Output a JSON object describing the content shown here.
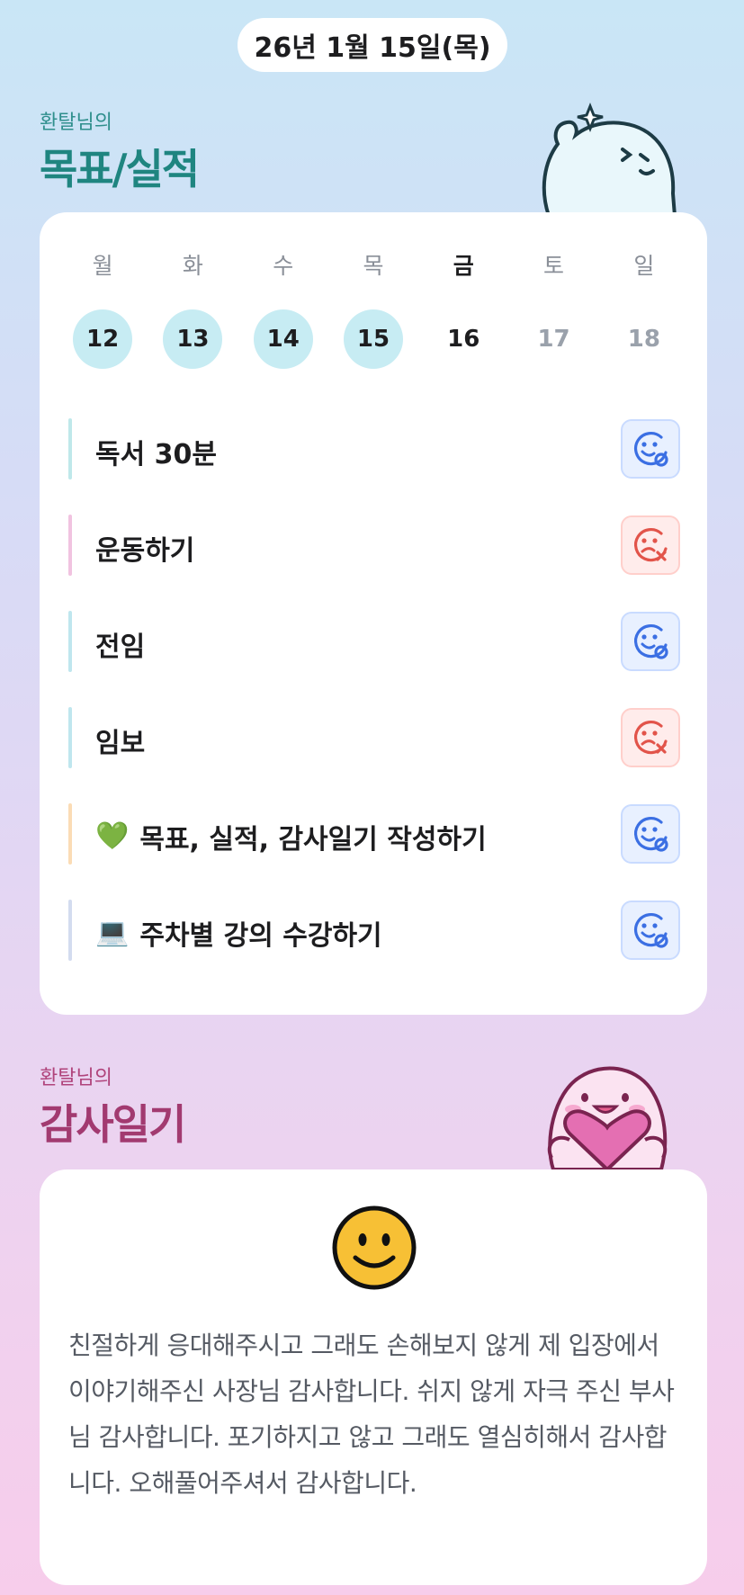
{
  "date_label": "26년 1월 15일(목)",
  "goals_section": {
    "subtitle": "환탈님의",
    "title": "목표/실적"
  },
  "week": {
    "days": [
      {
        "label": "월",
        "date": "12",
        "state": "done"
      },
      {
        "label": "화",
        "date": "13",
        "state": "done"
      },
      {
        "label": "수",
        "date": "14",
        "state": "done"
      },
      {
        "label": "목",
        "date": "15",
        "state": "done"
      },
      {
        "label": "금",
        "date": "16",
        "state": "today"
      },
      {
        "label": "토",
        "date": "17",
        "state": "future"
      },
      {
        "label": "일",
        "date": "18",
        "state": "future"
      }
    ]
  },
  "goals": [
    {
      "label": "독서 30분",
      "emoji": "",
      "status": "success",
      "bar_color": "#bfe8ea"
    },
    {
      "label": "운동하기",
      "emoji": "",
      "status": "fail",
      "bar_color": "#f1c3e0"
    },
    {
      "label": "전임",
      "emoji": "",
      "status": "success",
      "bar_color": "#bfe6ee"
    },
    {
      "label": "임보",
      "emoji": "",
      "status": "fail",
      "bar_color": "#bfe6ee"
    },
    {
      "label": "목표, 실적, 감사일기 작성하기",
      "emoji": "💚",
      "status": "success",
      "bar_color": "#fbdcb5"
    },
    {
      "label": "주차별 강의 수강하기",
      "emoji": "💻",
      "status": "success",
      "bar_color": "#d3dcef"
    }
  ],
  "diary_section": {
    "subtitle": "환탈님의",
    "title": "감사일기",
    "mood_icon": "smile-icon",
    "text": "친절하게 응대해주시고 그래도 손해보지 않게 제 입장에서 이야기해주신 사장님 감사합니다. 쉬지 않게 자극 주신 부사님 감사합니다. 포기하지고 않고 그래도 열심히해서 감사합니다. 오해풀어주셔서 감사합니다."
  },
  "colors": {
    "success": "#3b6fe3",
    "fail": "#e2544a",
    "goals_title": "#1f8580",
    "diary_title": "#a23a70"
  }
}
